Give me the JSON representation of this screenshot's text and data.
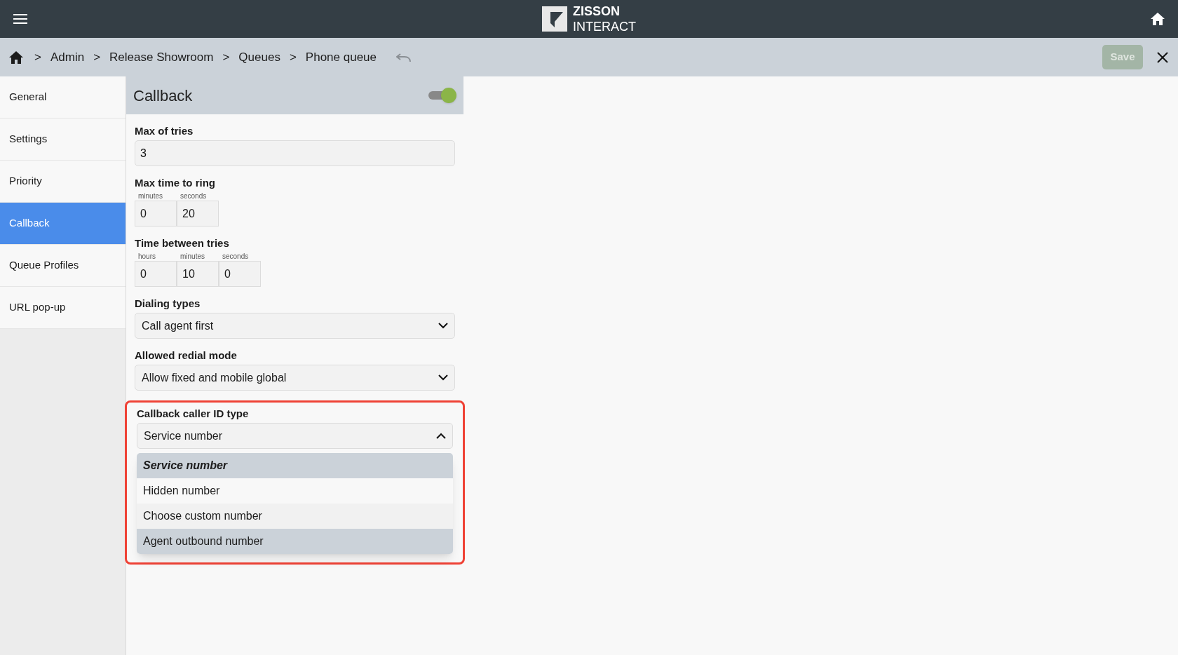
{
  "app_bar": {
    "logo_line_1": "ZISSON",
    "logo_line_2": "INTERACT"
  },
  "breadcrumb": {
    "items": [
      "Admin",
      "Release Showroom",
      "Queues",
      "Phone queue"
    ],
    "separator": ">"
  },
  "save_button": {
    "label": "Save",
    "disabled": true
  },
  "sidebar": {
    "items": [
      {
        "label": "General",
        "selected": false
      },
      {
        "label": "Settings",
        "selected": false
      },
      {
        "label": "Priority",
        "selected": false
      },
      {
        "label": "Callback",
        "selected": true
      },
      {
        "label": "Queue Profiles",
        "selected": false
      },
      {
        "label": "URL pop-up",
        "selected": false
      }
    ]
  },
  "panel": {
    "title": "Callback",
    "enabled": true,
    "fields": [
      {
        "kind": "text",
        "label": "Max of tries",
        "value": "3"
      },
      {
        "kind": "duration",
        "label": "Max time to ring",
        "parts": [
          {
            "unit": "minutes",
            "value": "0"
          },
          {
            "unit": "seconds",
            "value": "20"
          }
        ]
      },
      {
        "kind": "duration",
        "label": "Time between tries",
        "parts": [
          {
            "unit": "hours",
            "value": "0"
          },
          {
            "unit": "minutes",
            "value": "10"
          },
          {
            "unit": "seconds",
            "value": "0"
          }
        ]
      },
      {
        "kind": "select",
        "label": "Dialing types",
        "value": "Call agent first",
        "expanded": false
      },
      {
        "kind": "select",
        "label": "Allowed redial mode",
        "value": "Allow fixed and mobile global",
        "expanded": false
      },
      {
        "kind": "select",
        "label": "Callback caller ID type",
        "value": "Service number",
        "expanded": true,
        "highlighted": true,
        "options": [
          {
            "label": "Service number",
            "selected": true,
            "hovered": false
          },
          {
            "label": "Hidden number",
            "selected": false,
            "hovered": false
          },
          {
            "label": "Choose custom number",
            "selected": false,
            "hovered": false
          },
          {
            "label": "Agent outbound number",
            "selected": false,
            "hovered": true
          }
        ]
      }
    ]
  }
}
